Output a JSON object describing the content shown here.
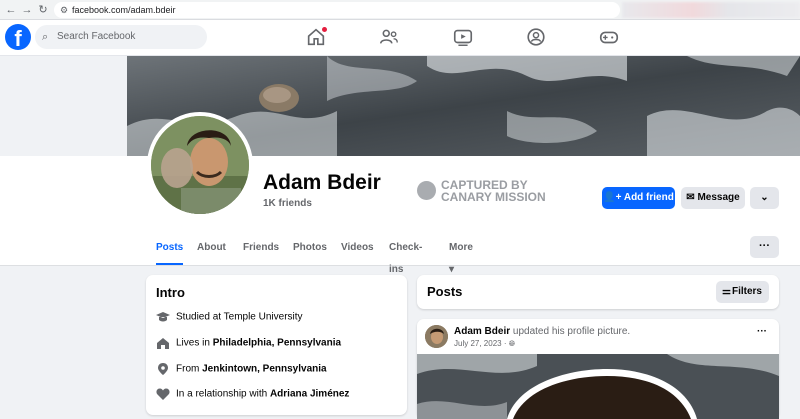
{
  "browser": {
    "url": "facebook.com/adam.bdeir"
  },
  "header": {
    "logo_letter": "f",
    "search_placeholder": "Search Facebook",
    "nav_icons": [
      "home-icon",
      "friends-icon",
      "watch-icon",
      "groups-icon",
      "gaming-icon"
    ]
  },
  "profile": {
    "name": "Adam Bdeir",
    "friends": "1K friends",
    "watermark_line1": "CAPTURED BY",
    "watermark_line2": "CANARY MISSION",
    "add_friend_label": "Add friend",
    "message_label": "Message",
    "more_label": "⌄"
  },
  "tabs": [
    {
      "label": "Posts",
      "active": true
    },
    {
      "label": "About"
    },
    {
      "label": "Friends"
    },
    {
      "label": "Photos"
    },
    {
      "label": "Videos"
    },
    {
      "label": "Check-ins"
    },
    {
      "label": "More ▾"
    }
  ],
  "tabs_more_dots": "···",
  "intro": {
    "title": "Intro",
    "items": [
      {
        "icon": "graduation-cap-icon",
        "prefix": "Studied at Temple University",
        "bold": ""
      },
      {
        "icon": "home-icon",
        "prefix": "Lives in ",
        "bold": "Philadelphia, Pennsylvania"
      },
      {
        "icon": "location-icon",
        "prefix": "From ",
        "bold": "Jenkintown, Pennsylvania"
      },
      {
        "icon": "heart-icon",
        "prefix": "In a relationship with ",
        "bold": "Adriana Jiménez"
      }
    ]
  },
  "posts": {
    "title": "Posts",
    "filters_label": "Filters",
    "post": {
      "author": "Adam Bdeir",
      "action": " updated his profile picture.",
      "date": "July 27, 2023 · ",
      "privacy_icon": "globe-icon",
      "menu": "···"
    }
  },
  "colors": {
    "brand": "#0866ff",
    "notification": "#e41e3f"
  }
}
